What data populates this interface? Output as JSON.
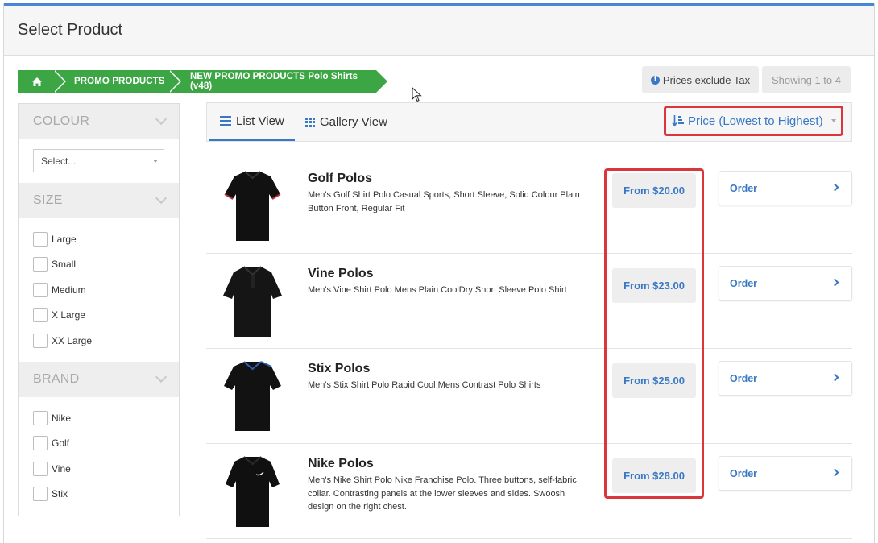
{
  "header": {
    "title": "Select Product"
  },
  "breadcrumb": {
    "home_icon": "home-icon",
    "items": [
      "PROMO PRODUCTS",
      "NEW PROMO PRODUCTS Polo Shirts (v48)"
    ]
  },
  "toolbar": {
    "tax_label": "Prices exclude Tax",
    "tax_icon": "info-icon",
    "showing_label": "Showing 1 to 4"
  },
  "filters": {
    "colour": {
      "title": "COLOUR",
      "select_value": "Select..."
    },
    "size": {
      "title": "SIZE",
      "options": [
        "Large",
        "Small",
        "Medium",
        "X Large",
        "XX Large"
      ]
    },
    "brand": {
      "title": "BRAND",
      "options": [
        "Nike",
        "Golf",
        "Vine",
        "Stix"
      ]
    }
  },
  "views": {
    "list_label": "List View",
    "gallery_label": "Gallery View",
    "sort_label": "Price (Lowest to Highest)"
  },
  "products": [
    {
      "name": "Golf Polos",
      "desc": "Men's Golf Shirt Polo Casual Sports, Short Sleeve, Solid Colour Plain Button Front, Regular Fit",
      "price": "From $20.00",
      "order": "Order"
    },
    {
      "name": "Vine Polos",
      "desc": "Men's Vine Shirt Polo Mens Plain CoolDry Short Sleeve Polo Shirt",
      "price": "From $23.00",
      "order": "Order"
    },
    {
      "name": "Stix Polos",
      "desc": "Men's Stix Shirt Polo Rapid Cool Mens Contrast Polo Shirts",
      "price": "From $25.00",
      "order": "Order"
    },
    {
      "name": "Nike Polos",
      "desc": "Men's Nike Shirt Polo Nike Franchise Polo. Three buttons, self-fabric collar. Contrasting panels at the lower sleeves and sides. Swoosh design on the right chest.",
      "price": "From $28.00",
      "order": "Order"
    }
  ],
  "colors": {
    "accent": "#3a78c4",
    "breadcrumb": "#3ca644",
    "highlight": "#d9373b"
  }
}
